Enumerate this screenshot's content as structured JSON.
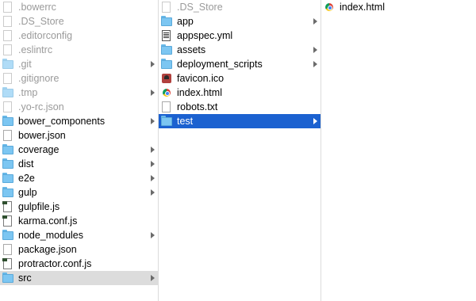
{
  "columns": [
    {
      "items": [
        {
          "name": ".bowerrc",
          "icon": "document-icon",
          "hidden": true
        },
        {
          "name": ".DS_Store",
          "icon": "document-icon",
          "hidden": true
        },
        {
          "name": ".editorconfig",
          "icon": "document-icon",
          "hidden": true
        },
        {
          "name": ".eslintrc",
          "icon": "document-icon",
          "hidden": true
        },
        {
          "name": ".git",
          "icon": "folder-icon",
          "hidden": true,
          "has_children": true
        },
        {
          "name": ".gitignore",
          "icon": "document-icon",
          "hidden": true
        },
        {
          "name": ".tmp",
          "icon": "folder-icon",
          "hidden": true,
          "has_children": true
        },
        {
          "name": ".yo-rc.json",
          "icon": "document-icon",
          "hidden": true
        },
        {
          "name": "bower_components",
          "icon": "folder-icon",
          "has_children": true
        },
        {
          "name": "bower.json",
          "icon": "document-icon"
        },
        {
          "name": "coverage",
          "icon": "folder-icon",
          "has_children": true
        },
        {
          "name": "dist",
          "icon": "folder-icon",
          "has_children": true
        },
        {
          "name": "e2e",
          "icon": "folder-icon",
          "has_children": true
        },
        {
          "name": "gulp",
          "icon": "folder-icon",
          "has_children": true
        },
        {
          "name": "gulpfile.js",
          "icon": "script-icon"
        },
        {
          "name": "karma.conf.js",
          "icon": "script-icon"
        },
        {
          "name": "node_modules",
          "icon": "folder-icon",
          "has_children": true
        },
        {
          "name": "package.json",
          "icon": "document-icon"
        },
        {
          "name": "protractor.conf.js",
          "icon": "script-icon"
        },
        {
          "name": "src",
          "icon": "folder-icon",
          "has_children": true,
          "selected": "inactive"
        }
      ]
    },
    {
      "items": [
        {
          "name": ".DS_Store",
          "icon": "document-icon",
          "hidden": true
        },
        {
          "name": "app",
          "icon": "folder-icon",
          "has_children": true
        },
        {
          "name": "appspec.yml",
          "icon": "yml-file-icon"
        },
        {
          "name": "assets",
          "icon": "folder-icon",
          "has_children": true
        },
        {
          "name": "deployment_scripts",
          "icon": "folder-icon",
          "has_children": true
        },
        {
          "name": "favicon.ico",
          "icon": "ico-file-icon"
        },
        {
          "name": "index.html",
          "icon": "chrome-html-icon"
        },
        {
          "name": "robots.txt",
          "icon": "document-icon"
        },
        {
          "name": "test",
          "icon": "folder-icon",
          "has_children": true,
          "selected": "active"
        }
      ]
    },
    {
      "items": [
        {
          "name": "index.html",
          "icon": "chrome-html-icon"
        }
      ]
    }
  ],
  "colors": {
    "selection_active": "#1b61d0",
    "selection_inactive": "#dcdcdc",
    "folder": "#7cc6f2",
    "hidden_text": "#9a9a9a"
  }
}
